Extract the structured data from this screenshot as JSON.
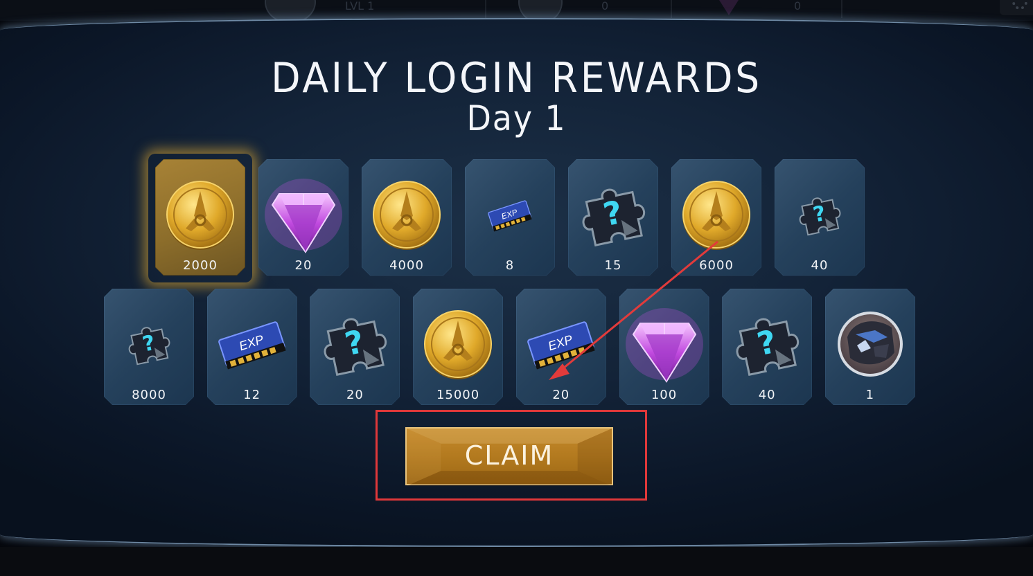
{
  "hud": {
    "level": "LVL 1",
    "coins": "0",
    "crystals": "0"
  },
  "popup": {
    "title": "DAILY LOGIN REWARDS",
    "subtitle": "Day 1"
  },
  "rewards_row1": [
    {
      "icon": "coin-icon",
      "value": "2000",
      "active": true
    },
    {
      "icon": "gem-icon",
      "value": "20"
    },
    {
      "icon": "coin-icon",
      "value": "4000"
    },
    {
      "icon": "exp-card-small-icon",
      "value": "8"
    },
    {
      "icon": "mystery-shard-icon",
      "value": "15"
    },
    {
      "icon": "coin-icon",
      "value": "6000"
    },
    {
      "icon": "mystery-shard-small-icon",
      "value": "40"
    }
  ],
  "rewards_row2": [
    {
      "icon": "mystery-shard-small-icon",
      "value": "8000"
    },
    {
      "icon": "exp-card-icon",
      "value": "12"
    },
    {
      "icon": "mystery-shard-icon",
      "value": "20"
    },
    {
      "icon": "coin-icon",
      "value": "15000"
    },
    {
      "icon": "exp-card-icon",
      "value": "20"
    },
    {
      "icon": "gem-icon",
      "value": "100"
    },
    {
      "icon": "mystery-shard-icon",
      "value": "40"
    },
    {
      "icon": "character-portrait-icon",
      "value": "1"
    }
  ],
  "claim": {
    "label": "CLAIM"
  },
  "colors": {
    "accent_gold": "#b37a1f",
    "highlight_red": "#e0383a",
    "tile_blue": "#25415c"
  }
}
